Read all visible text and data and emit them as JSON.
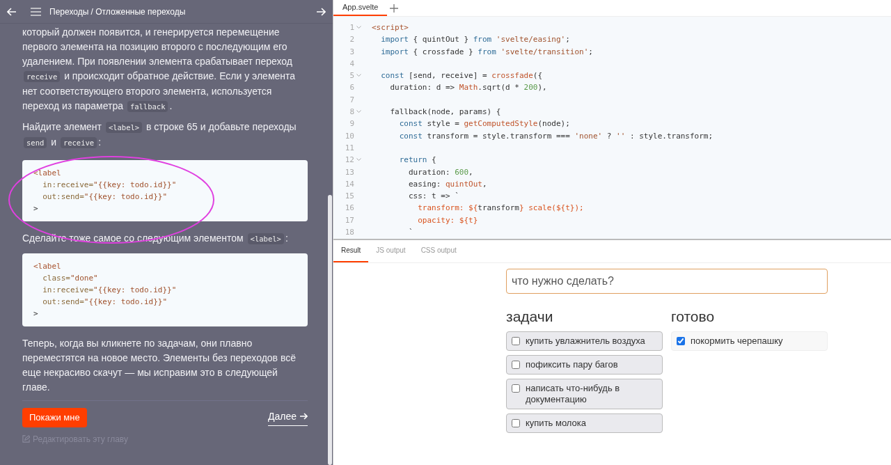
{
  "tutorial": {
    "breadcrumb": "Переходы / Отложенные переходы",
    "paragraphs": [
      [
        {
          "text": "который должен появится, и генерируется перемещение первого элемента на позицию второго с последующим его удалением. При появлении элемента срабатывает переход "
        },
        {
          "code": "receive"
        },
        {
          "text": " и происходит обратное действие. Если у элемента нет соответствующего второго элемента, используется переход из параметра "
        },
        {
          "code": "fallback"
        },
        {
          "text": "."
        }
      ],
      [
        {
          "text": "Найдите элемент "
        },
        {
          "code": "<label>"
        },
        {
          "text": " в строке 65 и добавьте переходы "
        },
        {
          "code": "send"
        },
        {
          "text": " и "
        },
        {
          "code": "receive"
        },
        {
          "text": ":"
        }
      ]
    ],
    "code_blocks": [
      {
        "lines": [
          [
            {
              "kind": "tag",
              "t": "<label"
            }
          ],
          [
            {
              "kind": "attr",
              "t": "  in:receive="
            },
            {
              "kind": "str",
              "t": "\"{{key: todo.id}}\""
            }
          ],
          [
            {
              "kind": "attr",
              "t": "  out:send="
            },
            {
              "kind": "str",
              "t": "\"{{key: todo.id}}\""
            }
          ],
          [
            {
              "kind": "plain",
              "t": ">"
            }
          ]
        ]
      },
      {
        "lines": [
          [
            {
              "kind": "tag",
              "t": "<label"
            }
          ],
          [
            {
              "kind": "attr",
              "t": "  class="
            },
            {
              "kind": "str",
              "t": "\"done\""
            }
          ],
          [
            {
              "kind": "attr",
              "t": "  in:receive="
            },
            {
              "kind": "str",
              "t": "\"{{key: todo.id}}\""
            }
          ],
          [
            {
              "kind": "attr",
              "t": "  out:send="
            },
            {
              "kind": "str",
              "t": "\"{{key: todo.id}}\""
            }
          ],
          [
            {
              "kind": "plain",
              "t": ">"
            }
          ]
        ]
      }
    ],
    "middle_paragraph": [
      {
        "text": "Сделайте тоже самое со следующим элементом "
      },
      {
        "code": "<label>"
      },
      {
        "text": ":"
      }
    ],
    "final_paragraph": [
      {
        "text": "Теперь, когда вы кликнете по задачам, они плавно переместятся на новое место. Элементы без переходов всё еще некрасиво скачут — мы исправим это в следующей главе."
      }
    ],
    "show_button": "Покажи мне",
    "next_link": "Далее",
    "edit_link": "Редактировать эту главу"
  },
  "editor": {
    "tabs": [
      {
        "label": "App.svelte",
        "selected": true
      }
    ],
    "lines": [
      {
        "n": "1",
        "fold": true,
        "tokens": [
          {
            "kind": "tag",
            "t": "<script>"
          }
        ]
      },
      {
        "n": "2",
        "fold": false,
        "tokens": [
          {
            "kind": "kw",
            "t": "  import"
          },
          {
            "kind": "plain",
            "t": " { quintOut } "
          },
          {
            "kind": "kw",
            "t": "from"
          },
          {
            "kind": "str",
            "t": " 'svelte/easing'"
          },
          {
            "kind": "plain",
            "t": ";"
          }
        ]
      },
      {
        "n": "3",
        "fold": false,
        "tokens": [
          {
            "kind": "kw",
            "t": "  import"
          },
          {
            "kind": "plain",
            "t": " { crossfade } "
          },
          {
            "kind": "kw",
            "t": "from"
          },
          {
            "kind": "str",
            "t": " 'svelte/transition'"
          },
          {
            "kind": "plain",
            "t": ";"
          }
        ]
      },
      {
        "n": "4",
        "fold": false
      },
      {
        "n": "5",
        "fold": true,
        "tokens": [
          {
            "kind": "kw",
            "t": "  const"
          },
          {
            "kind": "plain",
            "t": " [send, receive] = "
          },
          {
            "kind": "fn",
            "t": "crossfade"
          },
          {
            "kind": "plain",
            "t": "({"
          }
        ]
      },
      {
        "n": "6",
        "fold": false,
        "tokens": [
          {
            "kind": "plain",
            "t": "    duration: d => "
          },
          {
            "kind": "fn",
            "t": "Math"
          },
          {
            "kind": "plain",
            "t": ".sqrt(d * "
          },
          {
            "kind": "num",
            "t": "200"
          },
          {
            "kind": "plain",
            "t": "),"
          }
        ]
      },
      {
        "n": "7",
        "fold": false
      },
      {
        "n": "8",
        "fold": true,
        "tokens": [
          {
            "kind": "plain",
            "t": "    fallback(node, params) {"
          }
        ]
      },
      {
        "n": "9",
        "fold": false,
        "tokens": [
          {
            "kind": "kw",
            "t": "      const"
          },
          {
            "kind": "plain",
            "t": " style = "
          },
          {
            "kind": "fn",
            "t": "getComputedStyle"
          },
          {
            "kind": "plain",
            "t": "(node);"
          }
        ]
      },
      {
        "n": "10",
        "fold": false,
        "tokens": [
          {
            "kind": "kw",
            "t": "      const"
          },
          {
            "kind": "plain",
            "t": " transform = style.transform === "
          },
          {
            "kind": "str",
            "t": "'none'"
          },
          {
            "kind": "plain",
            "t": " ? "
          },
          {
            "kind": "str",
            "t": "''"
          },
          {
            "kind": "plain",
            "t": " : style.transform;"
          }
        ]
      },
      {
        "n": "11",
        "fold": false
      },
      {
        "n": "12",
        "fold": true,
        "tokens": [
          {
            "kind": "kw",
            "t": "      return"
          },
          {
            "kind": "plain",
            "t": " {"
          }
        ]
      },
      {
        "n": "13",
        "fold": false,
        "tokens": [
          {
            "kind": "plain",
            "t": "        duration: "
          },
          {
            "kind": "num",
            "t": "600"
          },
          {
            "kind": "plain",
            "t": ","
          }
        ]
      },
      {
        "n": "14",
        "fold": false,
        "tokens": [
          {
            "kind": "plain",
            "t": "        easing: "
          },
          {
            "kind": "fn",
            "t": "quintOut"
          },
          {
            "kind": "plain",
            "t": ","
          }
        ]
      },
      {
        "n": "15",
        "fold": false,
        "tokens": [
          {
            "kind": "plain",
            "t": "        css: t => `"
          }
        ]
      },
      {
        "n": "16",
        "fold": false,
        "tokens": [
          {
            "kind": "tpl",
            "t": "          transform: ${"
          },
          {
            "kind": "plain",
            "t": "transform"
          },
          {
            "kind": "tpl",
            "t": "} scale(${t});"
          }
        ]
      },
      {
        "n": "17",
        "fold": false,
        "tokens": [
          {
            "kind": "tpl",
            "t": "          opacity: ${t}"
          }
        ]
      },
      {
        "n": "18",
        "fold": false,
        "tokens": [
          {
            "kind": "plain",
            "t": "        `"
          }
        ]
      }
    ]
  },
  "output_tabs": [
    {
      "label": "Result",
      "selected": true
    },
    {
      "label": "JS output",
      "selected": false
    },
    {
      "label": "CSS output",
      "selected": false
    }
  ],
  "result": {
    "input": {
      "placeholder": "что нужно сделать?"
    },
    "columns": [
      {
        "title": "задачи",
        "items": [
          {
            "label": "купить увлажнитель воздуха",
            "checked": false
          },
          {
            "label": "пофиксить пару багов",
            "checked": false
          },
          {
            "label": "написать что-нибудь в документацию",
            "checked": false
          },
          {
            "label": "купить молока",
            "checked": false
          }
        ]
      },
      {
        "title": "готово",
        "items": [
          {
            "label": "покормить черепашку",
            "checked": true
          }
        ]
      }
    ]
  }
}
